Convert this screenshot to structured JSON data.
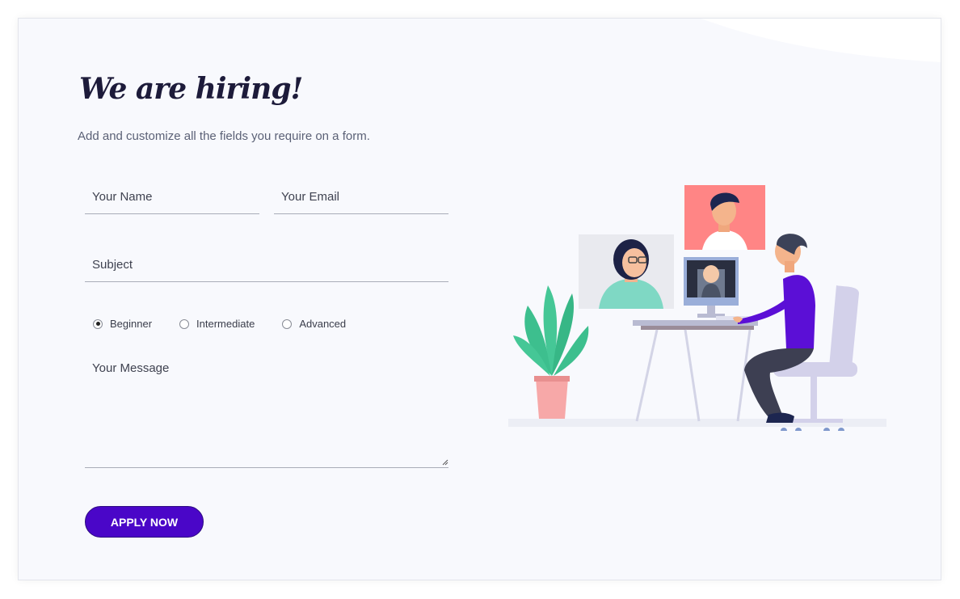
{
  "header": {
    "title": "We are hiring!",
    "subtitle": "Add and customize all the fields you require on a form."
  },
  "form": {
    "name_placeholder": "Your Name",
    "email_placeholder": "Your Email",
    "subject_placeholder": "Subject",
    "message_placeholder": "Your Message",
    "levels": [
      {
        "label": "Beginner",
        "checked": true
      },
      {
        "label": "Intermediate",
        "checked": false
      },
      {
        "label": "Advanced",
        "checked": false
      }
    ],
    "submit_label": "APPLY NOW"
  },
  "colors": {
    "accent": "#4a06c8",
    "title": "#1d1b3a",
    "background": "#f8f9fd"
  },
  "illustration": {
    "name": "video-call-hiring-illustration"
  }
}
